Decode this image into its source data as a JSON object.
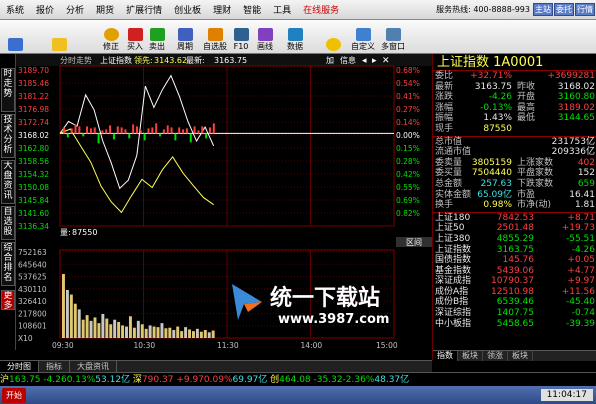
{
  "menu": {
    "items": [
      "系统",
      "报价",
      "分析",
      "期货",
      "扩展行情",
      "创业板",
      "理财",
      "智能",
      "工具",
      "在线服务"
    ],
    "hotline": "服务热线: 400-8888-993",
    "win_buttons": [
      "主站",
      "委托",
      "行情"
    ]
  },
  "toolbar": {
    "buttons": [
      "",
      "",
      "修正",
      "买入",
      "卖出",
      "周期",
      "自选股",
      "F10",
      "画线",
      "数据",
      "",
      "自定义",
      "多窗口"
    ]
  },
  "left_tabs": [
    "时走势",
    "技术分析",
    "大盘资讯",
    "自选股",
    "综合排名",
    "更多"
  ],
  "chart": {
    "header": "分时走势",
    "index_name": "上证指数",
    "lead_label": "领先:",
    "lead_value": "3143.62",
    "latest_label": "最新:",
    "latest_value": "3163.75",
    "controls": [
      "加",
      "信息"
    ],
    "price_ticks": [
      "3189.70",
      "3185.46",
      "3181.22",
      "3176.98",
      "3172.74",
      "3168.02",
      "3162.80",
      "3158.56",
      "3154.32",
      "3150.08",
      "3145.84",
      "3141.60",
      "3136.34"
    ],
    "pct_ticks": [
      "0.68%",
      "0.54%",
      "0.41%",
      "0.27%",
      "0.14%",
      "0.00%",
      "0.15%",
      "0.28%",
      "0.42%",
      "0.55%",
      "0.69%",
      "0.82%"
    ],
    "volume_label": "量:",
    "volume_value": "87550",
    "volume_ticks": [
      "752163",
      "645640",
      "537625",
      "430110",
      "326410",
      "217800",
      "108601",
      "X10"
    ],
    "volume_tab": "区间",
    "time_ticks": [
      "09:30",
      "10:30",
      "11:30",
      "14:00",
      "15:00"
    ]
  },
  "chart_data": {
    "type": "line",
    "title": "上证指数",
    "x": [
      "09:30",
      "10:30",
      "11:30"
    ],
    "series": [
      {
        "values": [
          3168.02,
          3172.1,
          3170.5,
          3181.2,
          3176.0,
          3165.5,
          3157.9,
          3149.2,
          3152.0,
          3160.5,
          3184.2,
          3176.9,
          3183.0,
          3187.8,
          3180.6,
          3172.0,
          3165.4,
          3170.2,
          3163.75
        ]
      },
      {
        "values": [
          3168.02,
          3169.5,
          3163.8,
          3158.2,
          3150.0,
          3144.6,
          3141.0,
          3146.8,
          3152.3,
          3149.5,
          3155.6,
          3160.0,
          3154.5,
          3150.2,
          3146.1,
          3143.62
        ]
      }
    ],
    "volume": [
      560000,
      420000,
      380000,
      300000,
      250000,
      160000,
      200000,
      150000,
      180000,
      130000,
      210000,
      170000,
      120000,
      160000,
      140000,
      110000,
      100000,
      190000,
      90000,
      150000,
      120000,
      80000,
      110000,
      100000,
      95000,
      130000,
      85000,
      90000,
      70000,
      100000,
      60000,
      95000,
      75000,
      60000,
      80000,
      55000,
      70000,
      50000,
      65000
    ],
    "ylim": [
      3136.34,
      3189.7
    ],
    "volume_ylim": [
      0,
      752163
    ]
  },
  "panel": {
    "title": "上证指数 1A0001",
    "rows": [
      {
        "l1": "委比",
        "v1": "+32.71%",
        "l2": "",
        "v2": "+3699281",
        "c1": "red",
        "c2": "red"
      },
      {
        "l1": "最新",
        "v1": "3163.75",
        "l2": "昨收",
        "v2": "3168.02",
        "c1": "wht",
        "c2": "wht"
      },
      {
        "l1": "涨跌",
        "v1": "-4.26",
        "l2": "开盘",
        "v2": "3160.80",
        "c1": "grn",
        "c2": "grn"
      },
      {
        "l1": "涨幅",
        "v1": "-0.13%",
        "l2": "最高",
        "v2": "3189.02",
        "c1": "grn",
        "c2": "red"
      },
      {
        "l1": "振幅",
        "v1": "1.43%",
        "l2": "最低",
        "v2": "3144.65",
        "c1": "wht",
        "c2": "grn"
      },
      {
        "l1": "现手",
        "v1": "87550",
        "l2": "",
        "v2": "",
        "c1": "yel",
        "c2": "wht"
      }
    ],
    "rows2": [
      {
        "l1": "总市值",
        "v1": "",
        "l2": "",
        "v2": "231753亿",
        "c1": "wht",
        "c2": "wht"
      },
      {
        "l1": "流通市值",
        "v1": "",
        "l2": "",
        "v2": "209336亿",
        "c1": "wht",
        "c2": "wht"
      },
      {
        "l1": "委卖量",
        "v1": "3805159",
        "l2": "上涨家数",
        "v2": "402",
        "c1": "yel",
        "c2": "red"
      },
      {
        "l1": "委买量",
        "v1": "7504440",
        "l2": "平盘家数",
        "v2": "152",
        "c1": "yel",
        "c2": "wht"
      },
      {
        "l1": "总金额",
        "v1": "257.63",
        "l2": "下跌家数",
        "v2": "659",
        "c1": "cyan",
        "c2": "grn"
      },
      {
        "l1": "实体金额",
        "v1": "65.09亿",
        "l2": "市盈",
        "v2": "16.41",
        "c1": "cyan",
        "c2": "wht"
      },
      {
        "l1": "换手",
        "v1": "0.98%",
        "l2": "市净(动)",
        "v2": "1.81",
        "c1": "yel",
        "c2": "wht"
      }
    ],
    "list": [
      {
        "name": "上证180",
        "price": "7842.53",
        "chg": "+8.71",
        "c": "red"
      },
      {
        "name": "上证50",
        "price": "2501.48",
        "chg": "+19.73",
        "c": "red"
      },
      {
        "name": "上证380",
        "price": "4855.29",
        "chg": "-55.51",
        "c": "grn"
      },
      {
        "name": "上证指数",
        "price": "3163.75",
        "chg": "-4.26",
        "c": "grn"
      },
      {
        "name": "国债指数",
        "price": "145.76",
        "chg": "+0.05",
        "c": "red"
      },
      {
        "name": "基金指数",
        "price": "5439.06",
        "chg": "+4.77",
        "c": "red"
      },
      {
        "name": "深证成指",
        "price": "10790.37",
        "chg": "+9.97",
        "c": "red"
      },
      {
        "name": "成份A指",
        "price": "12510.98",
        "chg": "+11.56",
        "c": "red"
      },
      {
        "name": "成份B指",
        "price": "6539.46",
        "chg": "-45.40",
        "c": "grn"
      },
      {
        "name": "深证综指",
        "price": "1407.75",
        "chg": "-0.74",
        "c": "grn"
      },
      {
        "name": "中小板指",
        "price": "5458.65",
        "chg": "-39.39",
        "c": "grn"
      }
    ],
    "tabs": [
      "指数",
      "板块",
      "领涨",
      "板块"
    ]
  },
  "bottom_tabs": [
    "分时图",
    "指标",
    "大盘资讯"
  ],
  "status": {
    "sh_label": "沪",
    "sh_value": "163.75",
    "sh_chg": "-4.26",
    "sh_pct": "0.13%",
    "sh_amt": "53.12亿",
    "sz_label": "深",
    "sz_value": "790.37",
    "sz_chg": "+9.97",
    "sz_pct": "0.09%",
    "sz_amt": "69.97亿",
    "cy_label": "创",
    "cy_value": "464.08",
    "cy_chg": "-35.32",
    "cy_pct": "-2.36%",
    "cy_amt": "48.37亿"
  },
  "taskbar": {
    "start": "开始",
    "clock": "11:04:17"
  },
  "watermark": {
    "line1": "统一下载站",
    "line2": "www.3987.com"
  },
  "colors": {
    "up": "#ff4040",
    "down": "#00e000",
    "price_line": "#ffffff",
    "avg_line": "#ffff54",
    "grid": "#800000",
    "bg": "#000000"
  }
}
